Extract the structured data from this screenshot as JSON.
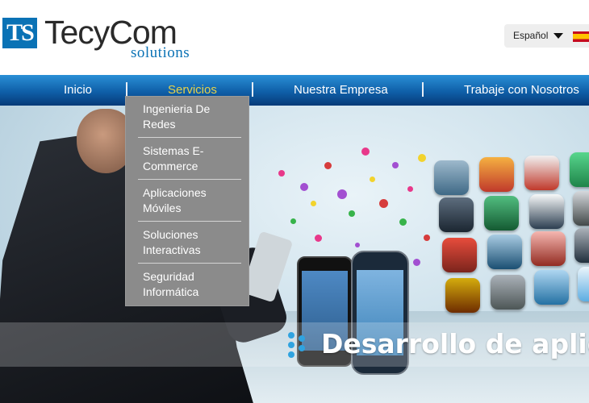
{
  "logo": {
    "mark": "TS",
    "name": "TecyCom",
    "tagline": "solutions"
  },
  "language": {
    "selected": "Español"
  },
  "nav": {
    "items": [
      {
        "label": "Inicio"
      },
      {
        "label": "Servicios"
      },
      {
        "label": "Nuestra Empresa"
      },
      {
        "label": "Trabaje con Nosotros"
      }
    ],
    "active": "Servicios"
  },
  "services_menu": {
    "items": [
      {
        "label": "Ingenieria De Redes"
      },
      {
        "label": "Sistemas E-Commerce"
      },
      {
        "label": "Aplicaciones Móviles"
      },
      {
        "label": "Soluciones Interactivas"
      },
      {
        "label": "Seguridad Informática"
      }
    ]
  },
  "banner": {
    "headline": "Desarrollo de aplicac",
    "accent_color": "#2fa3e0"
  },
  "colors": {
    "brand_blue": "#0a72b5",
    "nav_active": "#e6d24a",
    "dropdown_bg": "#8b8b8b"
  }
}
